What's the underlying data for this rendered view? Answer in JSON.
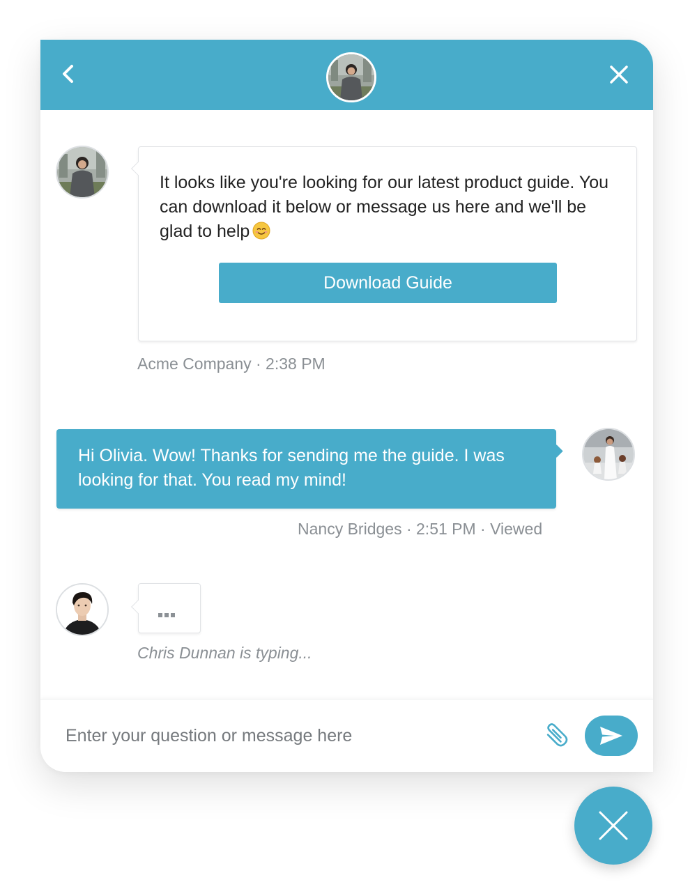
{
  "theme": {
    "accent": "#48acca",
    "meta_text": "#8a8f94",
    "text": "#222222"
  },
  "header": {
    "back_icon": "chevron-left-icon",
    "close_icon": "close-icon",
    "agent_avatar": "agent-avatar-olivia"
  },
  "messages": [
    {
      "direction": "incoming",
      "avatar": "agent-avatar-olivia",
      "text": "It looks like you're looking for our latest product guide. You can download it below or message us here and we'll be glad to help",
      "emoji": "smiling-face-emoji",
      "button_label": "Download Guide",
      "meta": "Acme Company · 2:38 PM"
    },
    {
      "direction": "outgoing",
      "avatar": "user-avatar-nancy",
      "text": "Hi Olivia. Wow! Thanks for sending me the guide. I was looking for that. You read my mind!",
      "meta": "Nancy Bridges · 2:51 PM · Viewed"
    }
  ],
  "typing": {
    "avatar": "agent-avatar-chris",
    "indicator": "...",
    "label": "Chris Dunnan is typing..."
  },
  "composer": {
    "value": "",
    "placeholder": "Enter your question or message here",
    "attach_icon": "paperclip-icon",
    "send_icon": "send-icon"
  },
  "launcher": {
    "icon": "close-icon"
  }
}
